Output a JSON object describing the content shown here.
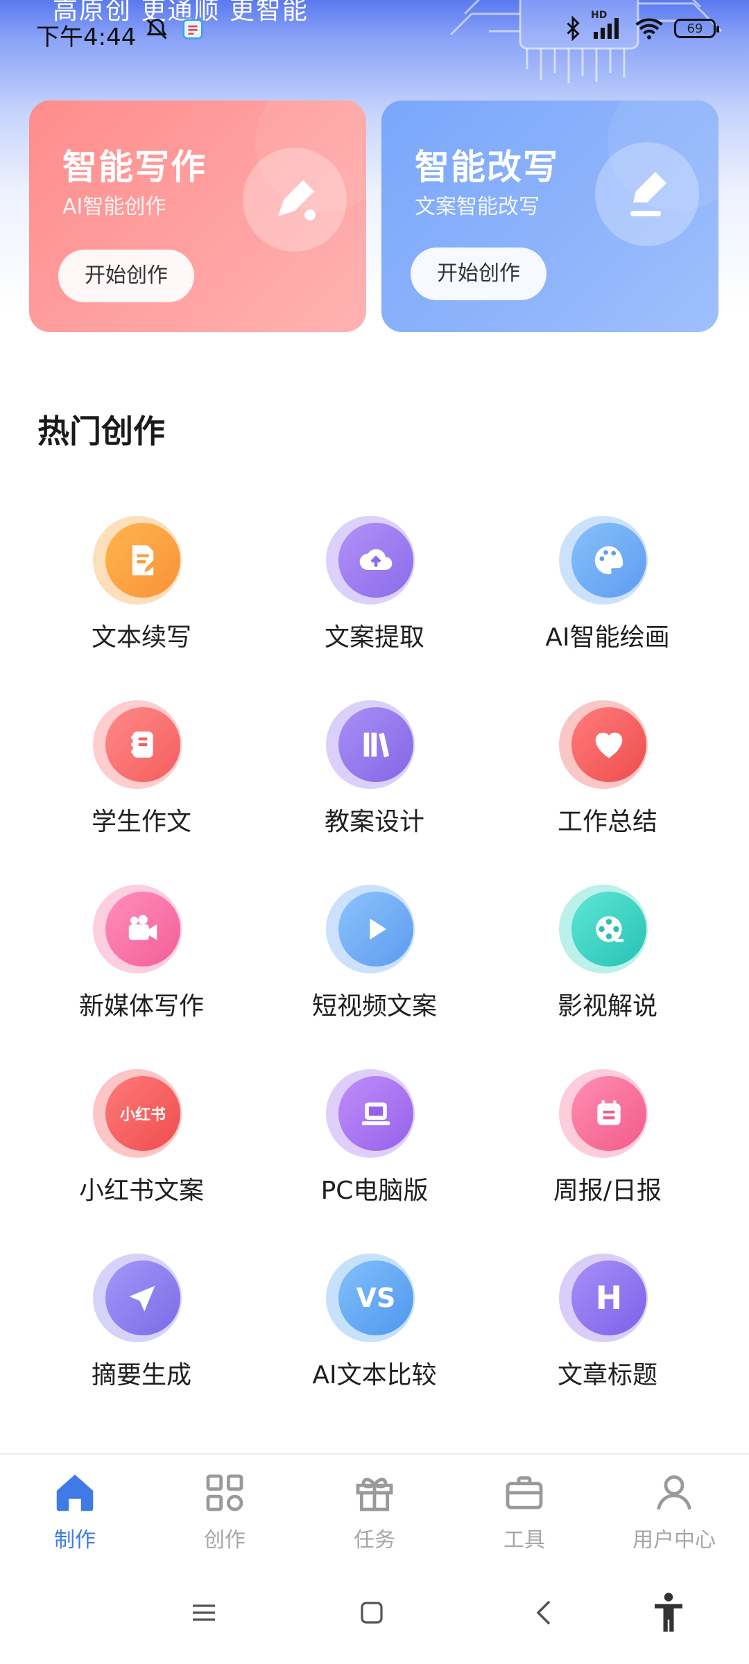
{
  "status_bar": {
    "slogan": "高原创  更通顺  更智能",
    "time": "下午4:44",
    "battery": "69",
    "network_label": "HD"
  },
  "cards": [
    {
      "title": "智能写作",
      "subtitle": "AI智能创作",
      "button": "开始创作",
      "icon": "pencil-icon"
    },
    {
      "title": "智能改写",
      "subtitle": "文案智能改写",
      "button": "开始创作",
      "icon": "edit-icon"
    }
  ],
  "section": {
    "title": "热门创作"
  },
  "tools": [
    {
      "label": "文本续写",
      "icon": "document-edit-icon",
      "color": "#fba33f"
    },
    {
      "label": "文案提取",
      "icon": "cloud-upload-icon",
      "color": "#9b7cf0"
    },
    {
      "label": "AI智能绘画",
      "icon": "palette-icon",
      "color": "#6aaaf5"
    },
    {
      "label": "学生作文",
      "icon": "notebook-icon",
      "color": "#fb6f6f"
    },
    {
      "label": "教案设计",
      "icon": "books-icon",
      "color": "#9677ef"
    },
    {
      "label": "工作总结",
      "icon": "heart-icon",
      "color": "#f25d5d"
    },
    {
      "label": "新媒体写作",
      "icon": "video-camera-icon",
      "color": "#f86fa6"
    },
    {
      "label": "短视频文案",
      "icon": "play-icon",
      "color": "#6aaaf5"
    },
    {
      "label": "影视解说",
      "icon": "film-reel-icon",
      "color": "#3fd5c6"
    },
    {
      "label": "小红书文案",
      "icon": "xiaohongshu-icon",
      "color": "#f55d5d",
      "badge": "小红书"
    },
    {
      "label": "PC电脑版",
      "icon": "laptop-icon",
      "color": "#a773f2"
    },
    {
      "label": "周报/日报",
      "icon": "calendar-icon",
      "color": "#f8709b"
    },
    {
      "label": "摘要生成",
      "icon": "send-icon",
      "color": "#8c7ef0"
    },
    {
      "label": "AI文本比较",
      "icon": "vs-icon",
      "color": "#5fa8f2",
      "badge": "VS"
    },
    {
      "label": "文章标题",
      "icon": "heading-icon",
      "color": "#8f74ef",
      "badge": "H"
    }
  ],
  "bottom_nav": [
    {
      "label": "制作",
      "icon": "home-icon",
      "active": true
    },
    {
      "label": "创作",
      "icon": "grid-icon",
      "active": false
    },
    {
      "label": "任务",
      "icon": "gift-icon",
      "active": false
    },
    {
      "label": "工具",
      "icon": "briefcase-icon",
      "active": false
    },
    {
      "label": "用户中心",
      "icon": "user-icon",
      "active": false
    }
  ],
  "colors": {
    "accent": "#3f7ae6",
    "nav_inactive": "#a6a6a6"
  }
}
